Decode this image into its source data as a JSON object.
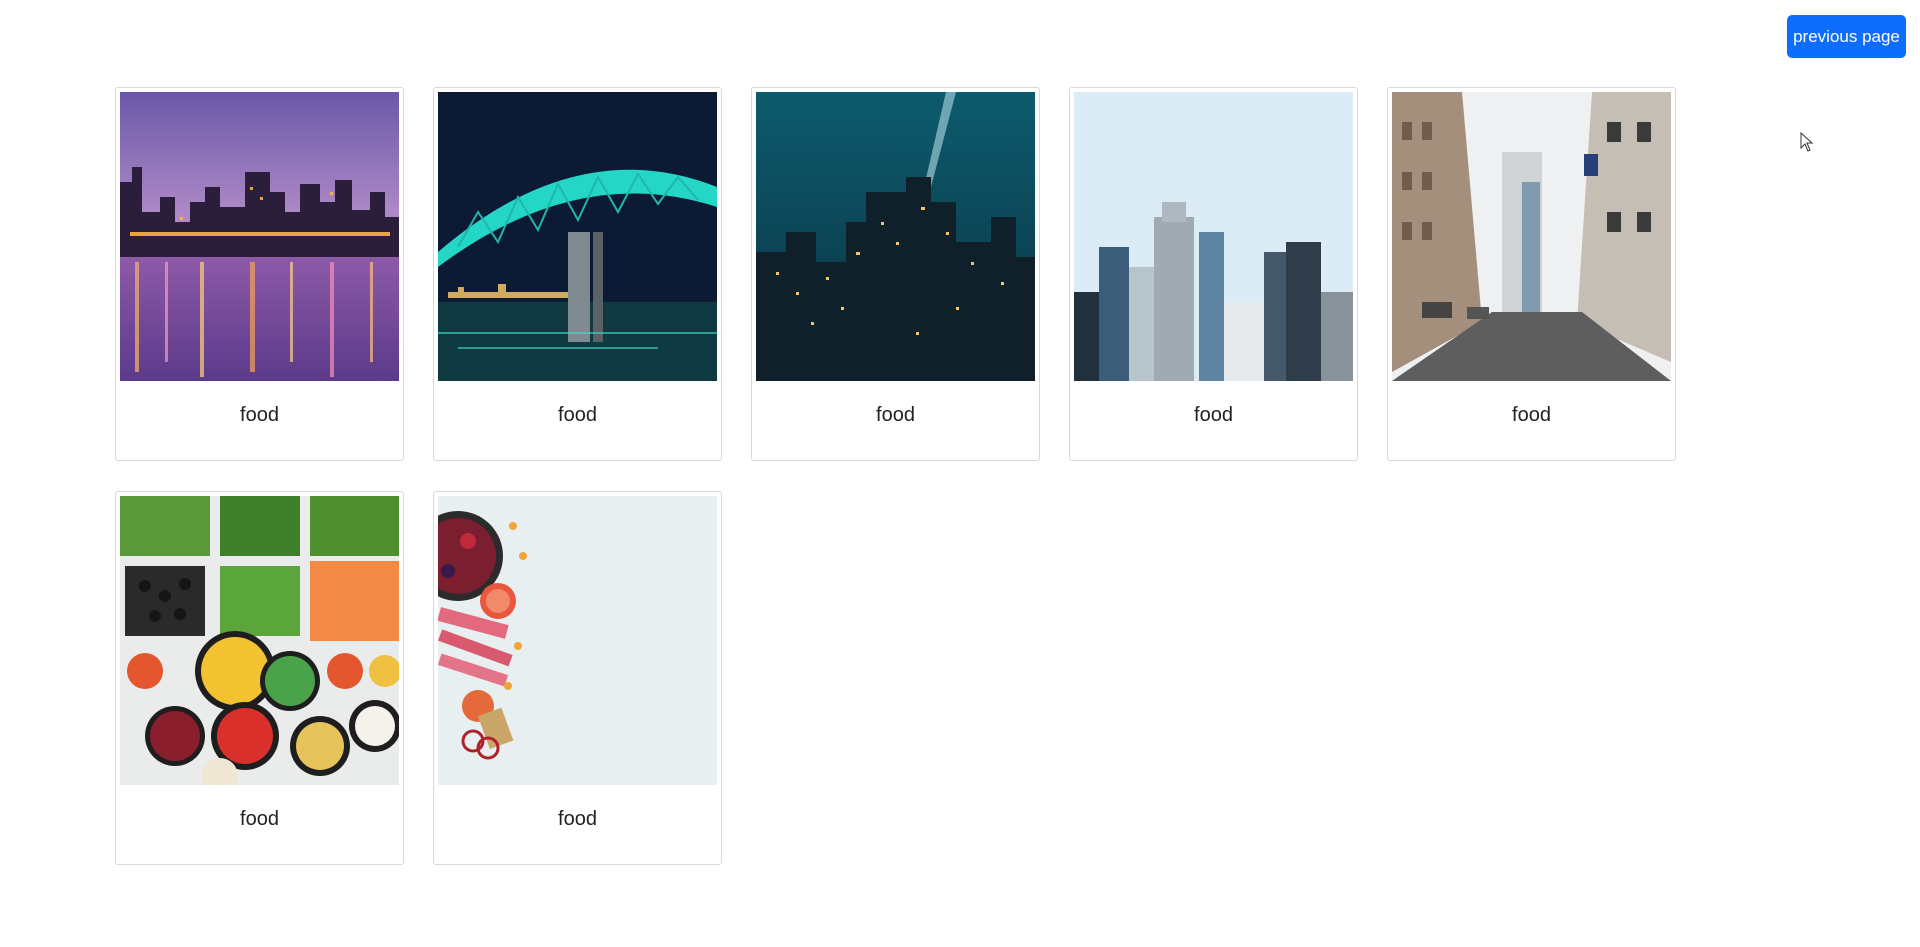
{
  "header": {
    "previous_page_label": "previous page"
  },
  "cards": [
    {
      "caption": "food",
      "image": "montreal-skyline-dusk"
    },
    {
      "caption": "food",
      "image": "jacques-cartier-bridge-night"
    },
    {
      "caption": "food",
      "image": "city-night-searchlight"
    },
    {
      "caption": "food",
      "image": "skyscrapers-daylight"
    },
    {
      "caption": "food",
      "image": "city-street-buildings"
    },
    {
      "caption": "food",
      "image": "vegetable-platter"
    },
    {
      "caption": "food",
      "image": "fruit-flatlay"
    }
  ],
  "colors": {
    "button": "#0d6efd",
    "card_border": "#d9d9d9"
  }
}
